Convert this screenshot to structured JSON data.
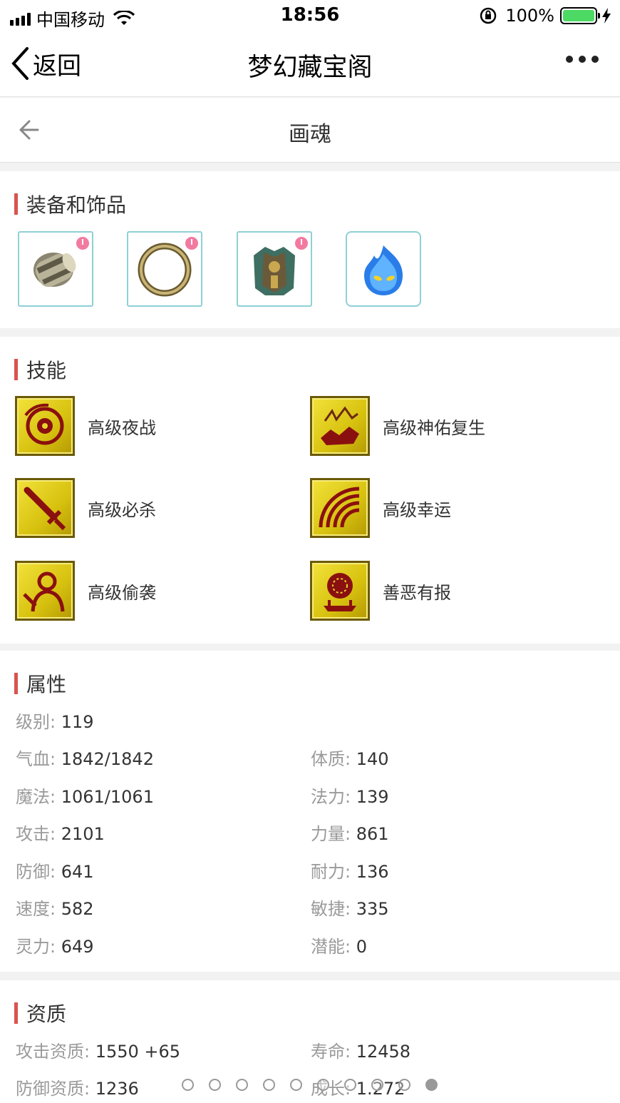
{
  "status_bar": {
    "carrier": "中国移动",
    "time": "18:56",
    "battery": "100%"
  },
  "nav": {
    "back_label": "返回",
    "title": "梦幻藏宝阁"
  },
  "page": {
    "title": "画魂"
  },
  "equipment": {
    "title": "装备和饰品",
    "items": [
      {
        "icon": "bracer-icon"
      },
      {
        "icon": "ring-icon"
      },
      {
        "icon": "armor-icon"
      },
      {
        "icon": "blue-flame-spirit-icon"
      }
    ]
  },
  "skills": {
    "title": "技能",
    "items": [
      {
        "label": "高级夜战"
      },
      {
        "label": "高级神佑复生"
      },
      {
        "label": "高级必杀"
      },
      {
        "label": "高级幸运"
      },
      {
        "label": "高级偷袭"
      },
      {
        "label": "善恶有报"
      }
    ]
  },
  "attributes": {
    "title": "属性",
    "level": {
      "key": "级别",
      "value": "119"
    },
    "rows": [
      {
        "key": "气血",
        "value": "1842/1842"
      },
      {
        "key": "体质",
        "value": "140"
      },
      {
        "key": "魔法",
        "value": "1061/1061"
      },
      {
        "key": "法力",
        "value": "139"
      },
      {
        "key": "攻击",
        "value": "2101"
      },
      {
        "key": "力量",
        "value": "861"
      },
      {
        "key": "防御",
        "value": "641"
      },
      {
        "key": "耐力",
        "value": "136"
      },
      {
        "key": "速度",
        "value": "582"
      },
      {
        "key": "敏捷",
        "value": "335"
      },
      {
        "key": "灵力",
        "value": "649"
      },
      {
        "key": "潜能",
        "value": "0"
      }
    ]
  },
  "aptitude": {
    "title": "资质",
    "rows": [
      {
        "key": "攻击资质",
        "value": "1550 +65"
      },
      {
        "key": "寿命",
        "value": "12458"
      },
      {
        "key": "防御资质",
        "value": "1236"
      },
      {
        "key": "成长",
        "value": "1.272"
      }
    ]
  },
  "pager": {
    "total": 10,
    "current": 10
  },
  "colors": {
    "accent": "#d9534f",
    "equip_border": "#8fd0d6"
  }
}
